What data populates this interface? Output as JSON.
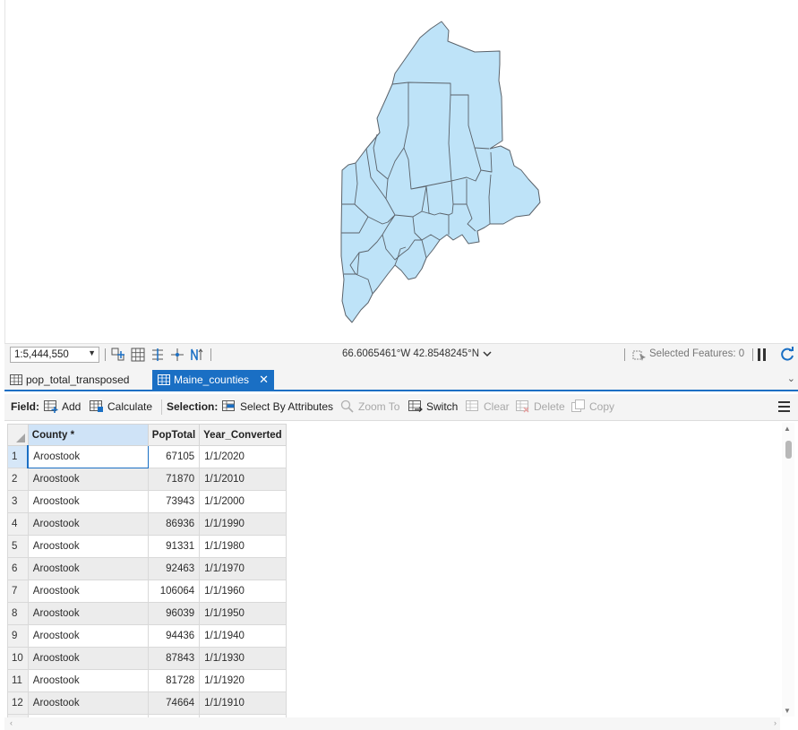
{
  "status_bar": {
    "scale": "1:5,444,550",
    "coordinates": "66.6065461°W 42.8548245°N",
    "selected_features": "Selected Features: 0"
  },
  "tabs": [
    {
      "label": "pop_total_transposed",
      "active": false
    },
    {
      "label": "Maine_counties",
      "active": true
    }
  ],
  "toolbar": {
    "field_label": "Field:",
    "add": "Add",
    "calculate": "Calculate",
    "selection_label": "Selection:",
    "select_by_attributes": "Select By Attributes",
    "zoom_to": "Zoom To",
    "switch": "Switch",
    "clear": "Clear",
    "delete": "Delete",
    "copy": "Copy"
  },
  "table": {
    "columns": [
      "County *",
      "PopTotal",
      "Year_Converted"
    ],
    "rows": [
      {
        "n": "1",
        "county": "Aroostook",
        "pop": "67105",
        "year": "1/1/2020"
      },
      {
        "n": "2",
        "county": "Aroostook",
        "pop": "71870",
        "year": "1/1/2010"
      },
      {
        "n": "3",
        "county": "Aroostook",
        "pop": "73943",
        "year": "1/1/2000"
      },
      {
        "n": "4",
        "county": "Aroostook",
        "pop": "86936",
        "year": "1/1/1990"
      },
      {
        "n": "5",
        "county": "Aroostook",
        "pop": "91331",
        "year": "1/1/1980"
      },
      {
        "n": "6",
        "county": "Aroostook",
        "pop": "92463",
        "year": "1/1/1970"
      },
      {
        "n": "7",
        "county": "Aroostook",
        "pop": "106064",
        "year": "1/1/1960"
      },
      {
        "n": "8",
        "county": "Aroostook",
        "pop": "96039",
        "year": "1/1/1950"
      },
      {
        "n": "9",
        "county": "Aroostook",
        "pop": "94436",
        "year": "1/1/1940"
      },
      {
        "n": "10",
        "county": "Aroostook",
        "pop": "87843",
        "year": "1/1/1930"
      },
      {
        "n": "11",
        "county": "Aroostook",
        "pop": "81728",
        "year": "1/1/1920"
      },
      {
        "n": "12",
        "county": "Aroostook",
        "pop": "74664",
        "year": "1/1/1910"
      }
    ]
  },
  "colors": {
    "county_fill": "#bee3f8",
    "county_stroke": "#555e66",
    "accent": "#1a6fc4"
  }
}
